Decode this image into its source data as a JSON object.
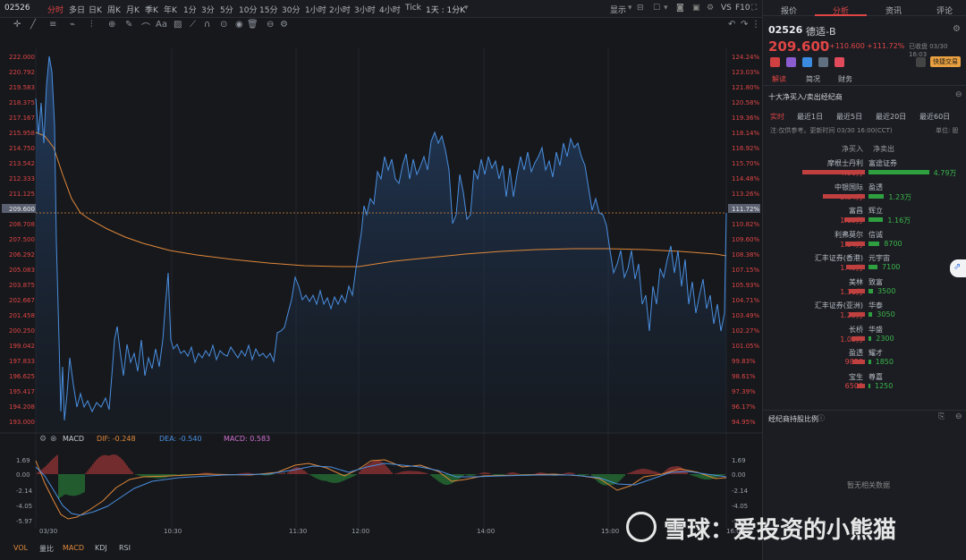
{
  "topbar": {
    "code": "02526",
    "periods": [
      "分时",
      "多日",
      "日K",
      "周K",
      "月K",
      "季K",
      "年K",
      "1分",
      "3分",
      "5分",
      "10分",
      "15分",
      "30分",
      "1小时",
      "2小时",
      "3小时",
      "4小时",
      "Tick"
    ],
    "range_select": "1天 : 1分K",
    "display": "显示",
    "vs": "VS",
    "f10": "F10"
  },
  "price_axis_left": [
    "222.000",
    "220.792",
    "219.583",
    "218.375",
    "217.167",
    "215.958",
    "214.750",
    "213.542",
    "212.333",
    "211.125",
    "209.600",
    "208.708",
    "207.500",
    "206.292",
    "205.083",
    "203.875",
    "202.667",
    "201.458",
    "200.250",
    "199.042",
    "197.833",
    "196.625",
    "195.417",
    "194.208",
    "193.000"
  ],
  "pct_axis_right": [
    "124.24%",
    "123.03%",
    "121.80%",
    "120.58%",
    "119.36%",
    "118.14%",
    "116.92%",
    "115.70%",
    "114.48%",
    "113.26%",
    "111.72%",
    "110.82%",
    "109.60%",
    "108.38%",
    "107.15%",
    "105.93%",
    "104.71%",
    "103.49%",
    "102.27%",
    "101.05%",
    "99.83%",
    "98.61%",
    "97.39%",
    "96.17%",
    "94.95%"
  ],
  "macd": {
    "name": "MACD",
    "dif_label": "DIF: -0.248",
    "dea_label": "DEA: -0.540",
    "macd_label": "MACD: 0.583",
    "axis_left": [
      "1.69",
      "0.00",
      "-2.14",
      "-4.05",
      "-5.97"
    ],
    "axis_right": [
      "1.69",
      "0.00",
      "-2.14",
      "-4.05",
      "-5.97"
    ]
  },
  "time_axis": [
    "03/30",
    "10:30",
    "11:30",
    "12:00",
    "14:00",
    "15:00",
    "16:00"
  ],
  "bottom_tabs": [
    "VOL",
    "量比",
    "MACD",
    "KDJ",
    "RSI"
  ],
  "right": {
    "tabs": [
      "报价",
      "分析",
      "资讯",
      "评论"
    ],
    "code": "02526",
    "name": "德适-B",
    "price": "209.600",
    "arrow": "⬆",
    "change": "+110.600",
    "change_pct": "+111.72%",
    "status": "已收盘 03/30 16:03",
    "trade_btn": "快捷交易",
    "subtabs": [
      "解读",
      "简况",
      "财务"
    ],
    "broker_title": "十大净买入/卖出经纪商",
    "periods": [
      "实时",
      "最近1日",
      "最近5日",
      "最近20日",
      "最近60日"
    ],
    "note": "注:仅供参考。更新时间 03/30 16:00(CCT)",
    "unit": "单位: 股",
    "col_buy": "净买入",
    "col_sell": "净卖出",
    "brokers": [
      {
        "buy_name": "摩根士丹利",
        "buy_val": "4.96万",
        "buy": 4.96,
        "sell_name": "富途证券",
        "sell_val": "4.79万",
        "sell": 4.79
      },
      {
        "buy_name": "中银国际",
        "buy_val": "3.34万",
        "buy": 3.34,
        "sell_name": "盈透",
        "sell_val": "1.23万",
        "sell": 1.23
      },
      {
        "buy_name": "富昌",
        "buy_val": "1.63万",
        "buy": 1.63,
        "sell_name": "辉立",
        "sell_val": "1.16万",
        "sell": 1.16
      },
      {
        "buy_name": "利弗莫尔",
        "buy_val": "1.54万",
        "buy": 1.54,
        "sell_name": "信诚",
        "sell_val": "8700",
        "sell": 0.87
      },
      {
        "buy_name": "汇丰证券(香港)",
        "buy_val": "1.49万",
        "buy": 1.49,
        "sell_name": "元宇宙",
        "sell_val": "7100",
        "sell": 0.71
      },
      {
        "buy_name": "美林",
        "buy_val": "1.31万",
        "buy": 1.31,
        "sell_name": "致富",
        "sell_val": "3500",
        "sell": 0.35
      },
      {
        "buy_name": "汇丰证券(亚洲)",
        "buy_val": "1.25万",
        "buy": 1.25,
        "sell_name": "华泰",
        "sell_val": "3050",
        "sell": 0.305
      },
      {
        "buy_name": "长桥",
        "buy_val": "1.03万",
        "buy": 1.03,
        "sell_name": "华盛",
        "sell_val": "2300",
        "sell": 0.23
      },
      {
        "buy_name": "盈透",
        "buy_val": "9850",
        "buy": 0.985,
        "sell_name": "耀才",
        "sell_val": "1850",
        "sell": 0.185
      },
      {
        "buy_name": "宝生",
        "buy_val": "6500",
        "buy": 0.65,
        "sell_name": "尊嘉",
        "sell_val": "1250",
        "sell": 0.125
      }
    ],
    "holding_title": "经纪商持股比例",
    "no_data": "暂无相关数据"
  },
  "watermark": "雪球：爱投资的小熊猫",
  "colors": {
    "up": "#e04545",
    "down": "#3bb54a",
    "price_line": "#4a8fe0",
    "avg_line": "#e0883a",
    "accent": "#e04545"
  }
}
